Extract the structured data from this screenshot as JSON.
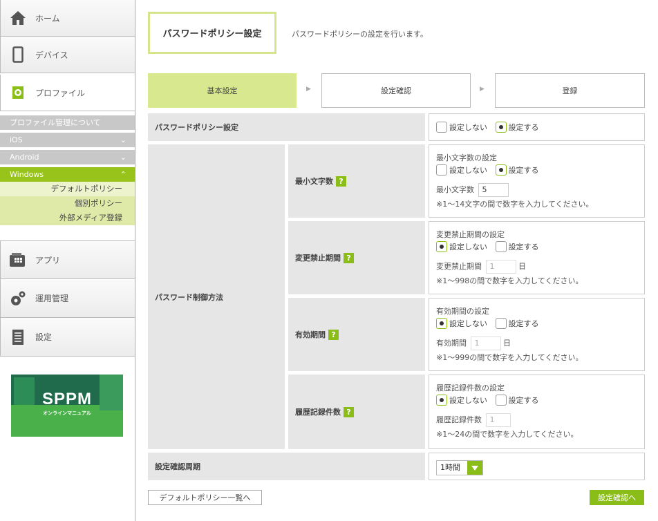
{
  "sidebar": {
    "home": "ホーム",
    "devices": "デバイス",
    "profile": "プロファイル",
    "sub_items": {
      "about": "プロファイル管理について",
      "ios": "iOS",
      "android": "Android",
      "windows": "Windows"
    },
    "windows_items": [
      "デフォルトポリシー",
      "個別ポリシー",
      "外部メディア登録"
    ],
    "apps": "アプリ",
    "operations": "運用管理",
    "settings": "設定",
    "banner_logo": "SPPM",
    "banner_sub": "オンラインマニュアル"
  },
  "header": {
    "title": "パスワードポリシー設定",
    "description": "パスワードポリシーの設定を行います。"
  },
  "steps": [
    "基本設定",
    "設定確認",
    "登録"
  ],
  "opts": {
    "off": "設定しない",
    "on": "設定する"
  },
  "form": {
    "policy_label": "パスワードポリシー設定",
    "policy_value": "on",
    "method_label": "パスワード制御方法",
    "rows": [
      {
        "label": "最小文字数",
        "heading": "最小文字数の設定",
        "value": "on",
        "input_label": "最小文字数",
        "input_value": "5",
        "unit": "",
        "note": "※1～14文字の間で数字を入力してください。"
      },
      {
        "label": "変更禁止期間",
        "heading": "変更禁止期間の設定",
        "value": "off",
        "input_label": "変更禁止期間",
        "input_value": "1",
        "unit": "日",
        "note": "※1～998の間で数字を入力してください。"
      },
      {
        "label": "有効期間",
        "heading": "有効期間の設定",
        "value": "off",
        "input_label": "有効期間",
        "input_value": "1",
        "unit": "日",
        "note": "※1～999の間で数字を入力してください。"
      },
      {
        "label": "履歴記録件数",
        "heading": "履歴記録件数の設定",
        "value": "off",
        "input_label": "履歴記録件数",
        "input_value": "1",
        "unit": "",
        "note": "※1～24の間で数字を入力してください。"
      }
    ],
    "check_label": "設定確認周期",
    "check_value": "1時間"
  },
  "buttons": {
    "default_list": "デフォルトポリシー一覧へ",
    "confirm": "設定確認へ"
  },
  "colors": {
    "accent": "#8bbd18",
    "accent_light": "#d7e88e"
  }
}
